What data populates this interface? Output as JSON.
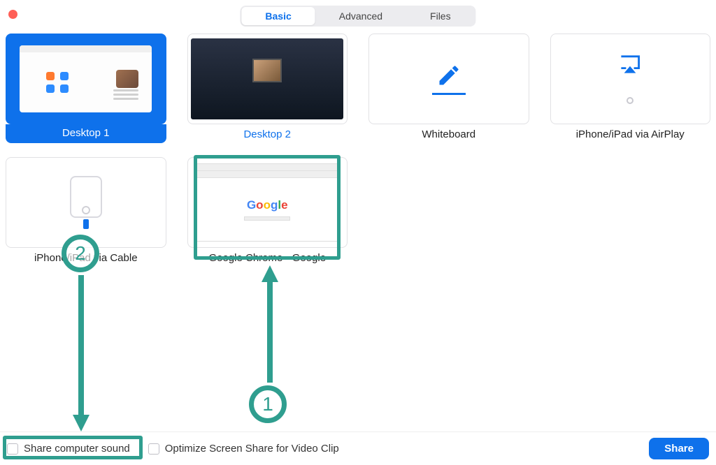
{
  "tabs": {
    "basic": "Basic",
    "advanced": "Advanced",
    "files": "Files"
  },
  "options": {
    "desktop1": "Desktop 1",
    "desktop2": "Desktop 2",
    "whiteboard": "Whiteboard",
    "airplay": "iPhone/iPad via AirPlay",
    "cable": "iPhone/iPad via Cable",
    "chrome": "Google Chrome - Google"
  },
  "checkboxes": {
    "share_sound": "Share computer sound",
    "optimize_video": "Optimize Screen Share for Video Clip"
  },
  "share_button": "Share",
  "annotations": {
    "step1": "1",
    "step2": "2"
  },
  "colors": {
    "primary": "#0e71eb",
    "annotation": "#2f9e8f"
  }
}
